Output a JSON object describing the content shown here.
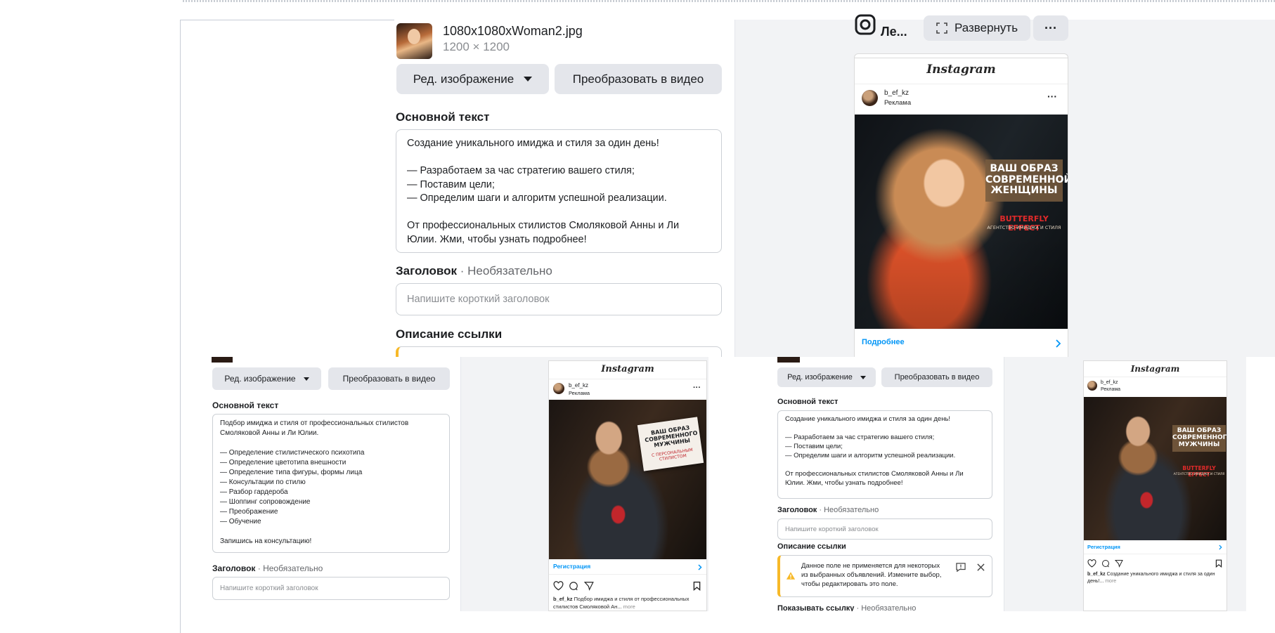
{
  "file": {
    "name": "1080x1080xWoman2.jpg",
    "dimensions": "1200 × 1200"
  },
  "editor": {
    "edit_image_label": "Ред. изображение",
    "convert_video_label": "Преобразовать в видео",
    "primary_text_title": "Основной текст",
    "primary_text_value": "Создание уникального имиджа и стиля за один день!\n\n— Разработаем за час стратегию вашего стиля;\n— Поставим цели;\n— Определим шаги и алгоритм успешной реализации.\n\nОт профессиональных стилистов Смоляковой Анны и Ли Юлии. Жми, чтобы узнать подробнее!",
    "headline_title": "Заголовок",
    "headline_optional": " · Необязательно",
    "headline_placeholder": "Напишите короткий заголовок",
    "link_desc_title": "Описание ссылки"
  },
  "preview_header": {
    "account_short": "Ле...",
    "expand_label": "Развернуть",
    "more_glyph": "···"
  },
  "ig_preview_1": {
    "brand": "Instagram",
    "username": "b_ef_kz",
    "sponsored": "Реклама",
    "more_glyph": "···",
    "image_title": "ВАШ ОБРАЗ\nСОВРЕМЕННОЙ\nЖЕНЩИНЫ",
    "image_brand": "BUTTERFLY EFFECT",
    "image_tagline": "АГЕНТСТВО ИМИДЖА И СТИЛЯ",
    "cta": "Подробнее"
  },
  "panel_left": {
    "edit_image_label": "Ред. изображение",
    "convert_video_label": "Преобразовать в видео",
    "primary_text_title": "Основной текст",
    "primary_text_value": "Подбор имиджа и стиля от профессиональных стилистов Смоляковой Анны и Ли Юлии.\n\n— Определение стилистического психотипа\n— Определение цветотипа внешности\n— Определение типа фигуры, формы лица\n— Консультации по стилю\n— Разбор гардероба\n— Шоппинг сопровождение\n— Преображение\n— Обучение\n\nЗапишись на консультацию!",
    "headline_title": "Заголовок",
    "headline_optional": " · Необязательно",
    "headline_placeholder": "Напишите короткий заголовок"
  },
  "ig_preview_2": {
    "brand": "Instagram",
    "username": "b_ef_kz",
    "sponsored": "Реклама",
    "more_glyph": "···",
    "image_title": "ВАШ ОБРАЗ\nСОВРЕМЕННОГО\nМУЖЧИНЫ",
    "image_sub": "С ПЕРСОНАЛЬНЫМ\nСТИЛИСТОМ",
    "cta": "Регистрация",
    "caption_user": "b_ef_kz",
    "caption_text": " Подбор имиджа и стиля от профессиональных стилистов Смоляковой Ан...",
    "caption_more": " more"
  },
  "panel_right": {
    "edit_image_label": "Ред. изображение",
    "convert_video_label": "Преобразовать в видео",
    "primary_text_title": "Основной текст",
    "primary_text_value": "Создание уникального имиджа и стиля за один день!\n\n— Разработаем за час стратегию вашего стиля;\n— Поставим цели;\n— Определим шаги и алгоритм успешной реализации.\n\nОт профессиональных стилистов Смоляковой Анны и Ли Юлии. Жми, чтобы узнать подробнее!",
    "headline_title": "Заголовок",
    "headline_optional": " · Необязательно",
    "headline_placeholder": "Напишите короткий заголовок",
    "link_desc_title": "Описание ссылки",
    "warning_text": "Данное поле не применяется для некоторых из выбранных объявлений. Измените выбор, чтобы редактировать это поле.",
    "show_link_title": "Показывать ссылку",
    "show_link_optional": " · Необязательно"
  },
  "ig_preview_3": {
    "brand": "Instagram",
    "username": "b_ef_kz",
    "sponsored": "Реклама",
    "image_title": "ВАШ ОБРАЗ\nСОВРЕМЕННОГО\nМУЖЧИНЫ",
    "image_brand": "BUTTERFLY EFFECT",
    "image_tagline": "АГЕНТСТВО ИМИДЖА И СТИЛЯ",
    "cta": "Регистрация",
    "caption_user": "b_ef_kz",
    "caption_text": " Создание уникального имиджа и стиля за один день!...",
    "caption_more": " more"
  },
  "colors": {
    "accent_link": "#0095f6",
    "button_bg": "#e4e6eb",
    "warning": "#f7b928",
    "panel_gray": "#f2f3f5"
  }
}
